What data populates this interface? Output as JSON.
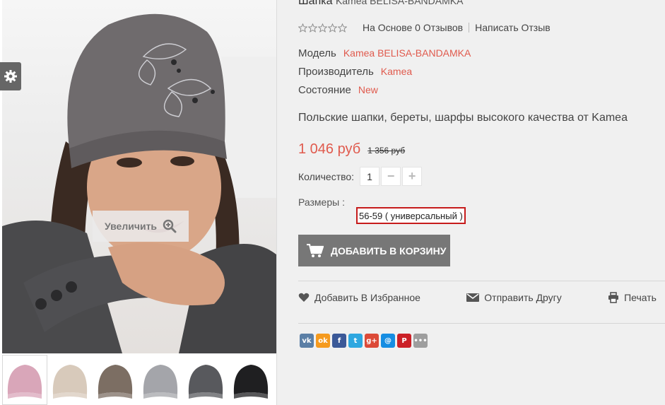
{
  "product": {
    "title": "Шапка",
    "subtitle": "Kamea BELISA-BANDAMKA",
    "rating_text": "На Основе 0 Отзывов",
    "write_review": "Написать Отзыв",
    "rating_stars": 0,
    "specs": [
      {
        "label": "Модель",
        "value": "Kamea BELISA-BANDAMKA"
      },
      {
        "label": "Производитель",
        "value": "Kamea"
      },
      {
        "label": "Состояние",
        "value": "New"
      }
    ],
    "description": "Польские шапки, береты, шарфы высокого качества от Kamea",
    "price_new": "1 046 руб",
    "price_old": "1 356 руб",
    "qty_label": "Количество:",
    "qty_value": "1",
    "qty_minus": "−",
    "qty_plus": "+",
    "sizes_label": "Размеры :",
    "size_option": "56-59 ( универсальный )",
    "cart_button": "ДОБАВИТЬ В КОРЗИНУ"
  },
  "gallery": {
    "zoom_label": "Увеличить",
    "thumb_colors": [
      "#d9a6b9",
      "#d8cabb",
      "#7c6e63",
      "#a4a5aa",
      "#58595d",
      "#1f1f21"
    ]
  },
  "actions": {
    "wishlist": "Добавить В Избранное",
    "send_friend": "Отправить Другу",
    "print": "Печать"
  },
  "share": [
    {
      "icon": "vk-icon",
      "glyph": "vk",
      "color": "#5b7fa6"
    },
    {
      "icon": "odnoklassniki-icon",
      "glyph": "ok",
      "color": "#f59a1e"
    },
    {
      "icon": "facebook-icon",
      "glyph": "f",
      "color": "#3b5998"
    },
    {
      "icon": "twitter-icon",
      "glyph": "t",
      "color": "#2ea7e0"
    },
    {
      "icon": "google-plus-icon",
      "glyph": "g+",
      "color": "#dc4a38"
    },
    {
      "icon": "mailru-icon",
      "glyph": "@",
      "color": "#168de2"
    },
    {
      "icon": "pinterest-icon",
      "glyph": "P",
      "color": "#cb2027"
    },
    {
      "icon": "more-icon",
      "glyph": "•••",
      "color": "#9e9e9e"
    }
  ],
  "colors": {
    "accent": "#e05a4d",
    "cart_button": "#777777",
    "size_border": "#c61b1b"
  }
}
